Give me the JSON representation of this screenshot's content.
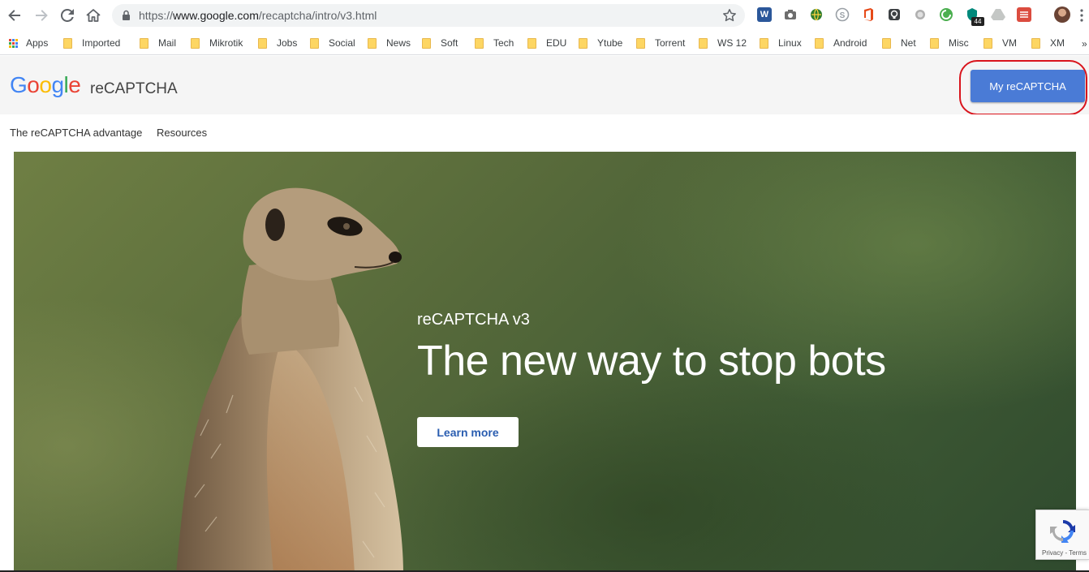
{
  "browser": {
    "url_prefix": "https://",
    "url_host": "www.google.com",
    "url_path": "/recaptcha/intro/v3.html",
    "extension_badge": "44",
    "extension_letter": "W",
    "menu_more": "»"
  },
  "bookmarks": [
    {
      "label": "Apps"
    },
    {
      "label": "Imported"
    },
    {
      "label": "Mail"
    },
    {
      "label": "Mikrotik"
    },
    {
      "label": "Jobs"
    },
    {
      "label": "Social"
    },
    {
      "label": "News"
    },
    {
      "label": "Soft"
    },
    {
      "label": "Tech"
    },
    {
      "label": "EDU"
    },
    {
      "label": "Ytube"
    },
    {
      "label": "Torrent"
    },
    {
      "label": "WS 12"
    },
    {
      "label": "Linux"
    },
    {
      "label": "Android"
    },
    {
      "label": "Net"
    },
    {
      "label": "Misc"
    },
    {
      "label": "VM"
    },
    {
      "label": "XM"
    }
  ],
  "header": {
    "logo_letters": [
      "G",
      "o",
      "o",
      "g",
      "l",
      "e"
    ],
    "product": "reCAPTCHA",
    "my_button": "My reCAPTCHA"
  },
  "subnav": {
    "advantage": "The reCAPTCHA advantage",
    "resources": "Resources"
  },
  "hero": {
    "subtitle": "reCAPTCHA v3",
    "title": "The new way to stop bots",
    "cta": "Learn more"
  },
  "badge": {
    "privacy": "Privacy",
    "separator": " - ",
    "terms": "Terms"
  },
  "colors": {
    "accent_blue": "#4a7bd6",
    "annotation_red": "#d9141c",
    "google_blue": "#4285f4",
    "google_red": "#ea4335",
    "google_yellow": "#fbbc05",
    "google_green": "#34a853"
  }
}
